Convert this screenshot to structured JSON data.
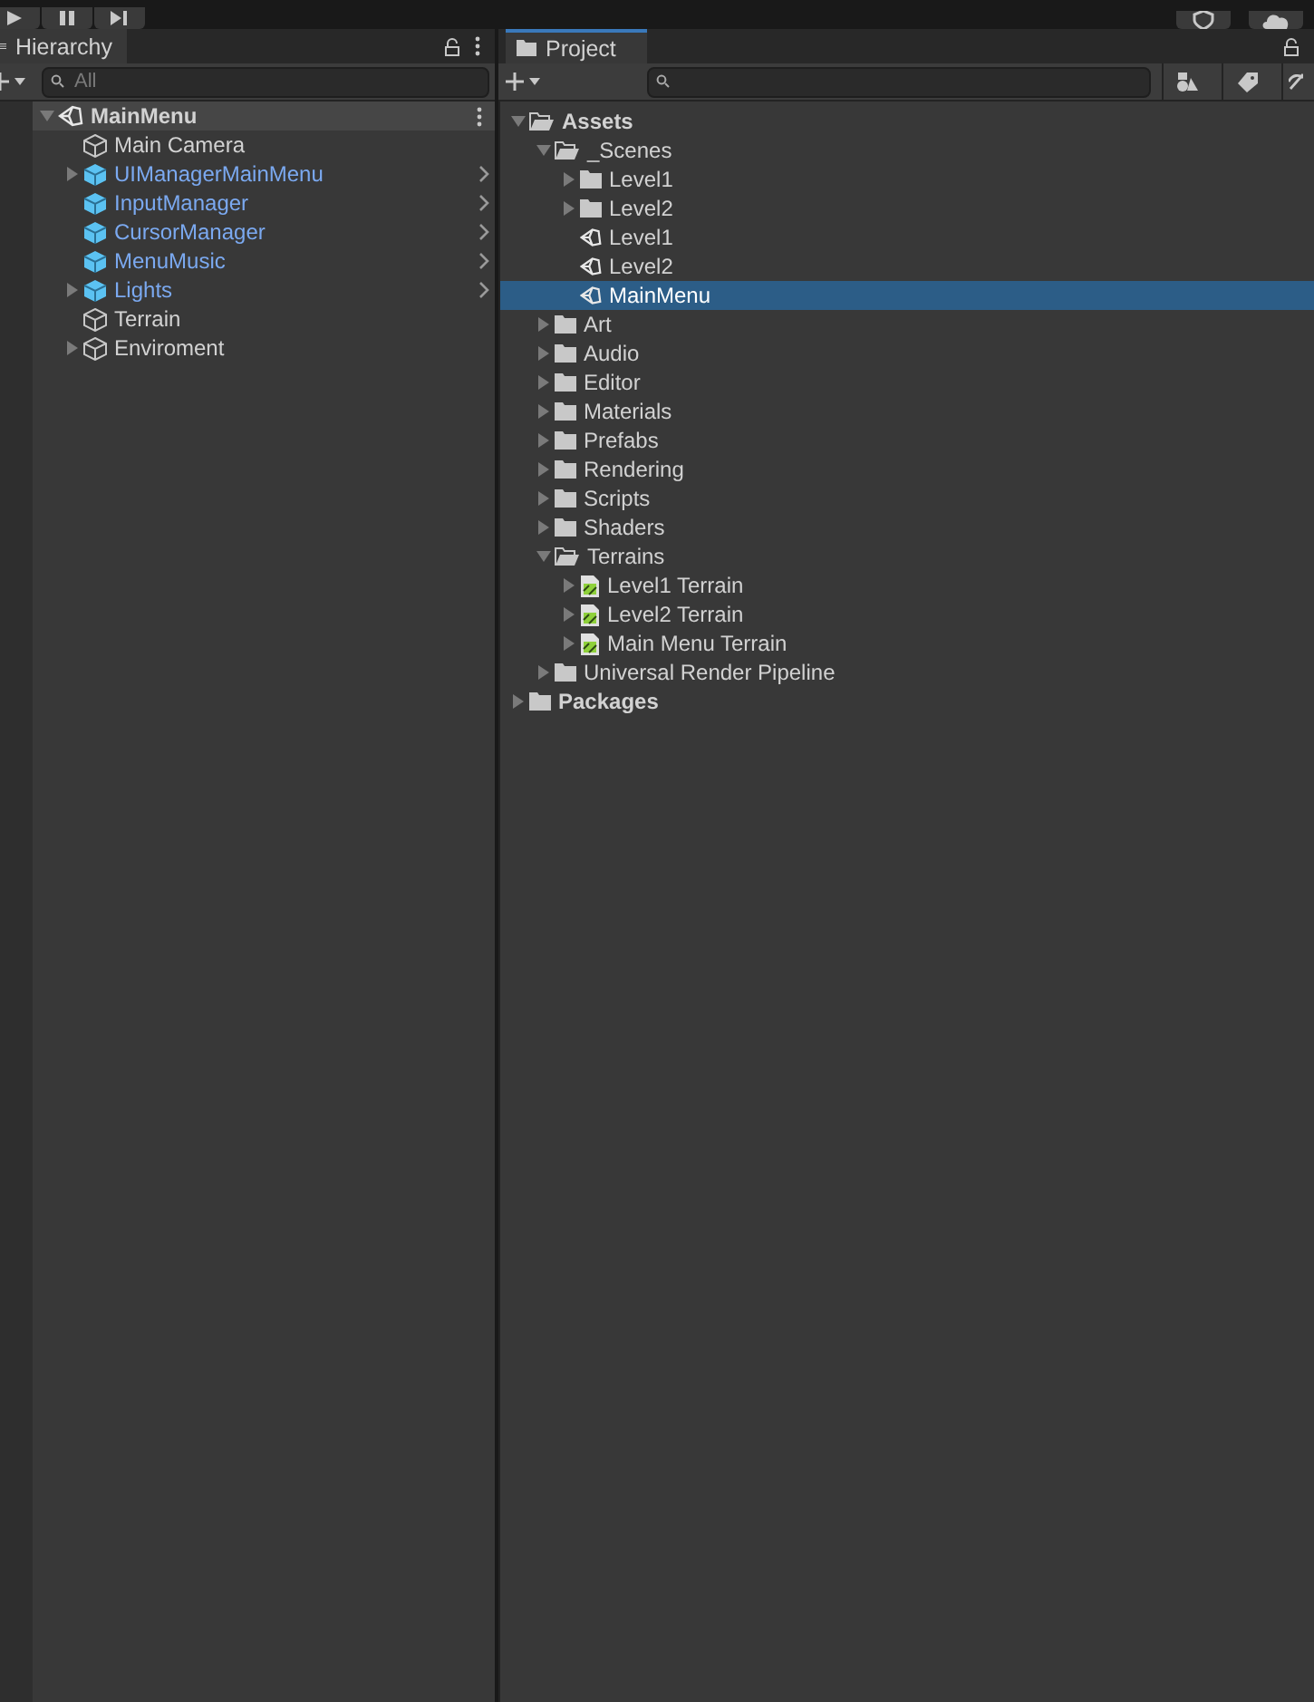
{
  "hierarchy": {
    "tab": "Hierarchy",
    "search": {
      "placeholder": "All"
    },
    "items": [
      {
        "label": "MainMenu",
        "kind": "scene",
        "expanded": true,
        "children": [
          {
            "label": "Main Camera",
            "kind": "object"
          },
          {
            "label": "UIManagerMainMenu",
            "kind": "prefab",
            "expanded": false
          },
          {
            "label": "InputManager",
            "kind": "prefab"
          },
          {
            "label": "CursorManager",
            "kind": "prefab"
          },
          {
            "label": "MenuMusic",
            "kind": "prefab"
          },
          {
            "label": "Lights",
            "kind": "prefab",
            "expanded": false
          },
          {
            "label": "Terrain",
            "kind": "object"
          },
          {
            "label": "Enviroment",
            "kind": "object",
            "expanded": false
          }
        ]
      }
    ]
  },
  "project": {
    "tab": "Project",
    "items": [
      {
        "label": "Assets",
        "kind": "folder",
        "root": true,
        "expanded": true,
        "selected": false,
        "children": [
          {
            "label": "_Scenes",
            "kind": "folder",
            "expanded": true,
            "selected": false,
            "children": [
              {
                "label": "Level1",
                "kind": "folder",
                "expanded": false,
                "selected": false
              },
              {
                "label": "Level2",
                "kind": "folder",
                "expanded": false,
                "selected": false
              },
              {
                "label": "Level1",
                "kind": "scene",
                "selected": false
              },
              {
                "label": "Level2",
                "kind": "scene",
                "selected": false
              },
              {
                "label": "MainMenu",
                "kind": "scene",
                "selected": true
              }
            ]
          },
          {
            "label": "Art",
            "kind": "folder",
            "expanded": false,
            "selected": false
          },
          {
            "label": "Audio",
            "kind": "folder",
            "expanded": false,
            "selected": false
          },
          {
            "label": "Editor",
            "kind": "folder",
            "expanded": false,
            "selected": false
          },
          {
            "label": "Materials",
            "kind": "folder",
            "expanded": false,
            "selected": false
          },
          {
            "label": "Prefabs",
            "kind": "folder",
            "expanded": false,
            "selected": false
          },
          {
            "label": "Rendering",
            "kind": "folder",
            "expanded": false,
            "selected": false
          },
          {
            "label": "Scripts",
            "kind": "folder",
            "expanded": false,
            "selected": false
          },
          {
            "label": "Shaders",
            "kind": "folder",
            "expanded": false,
            "selected": false
          },
          {
            "label": "Terrains",
            "kind": "folder",
            "expanded": true,
            "selected": false,
            "children": [
              {
                "label": "Level1 Terrain",
                "kind": "terrain",
                "expanded": false,
                "selected": false
              },
              {
                "label": "Level2 Terrain",
                "kind": "terrain",
                "expanded": false,
                "selected": false
              },
              {
                "label": "Main Menu Terrain",
                "kind": "terrain",
                "expanded": false,
                "selected": false
              }
            ]
          },
          {
            "label": "Universal Render Pipeline",
            "kind": "folder",
            "expanded": false,
            "selected": false
          }
        ]
      },
      {
        "label": "Packages",
        "kind": "folder",
        "root": true,
        "expanded": false,
        "selected": false
      }
    ]
  }
}
